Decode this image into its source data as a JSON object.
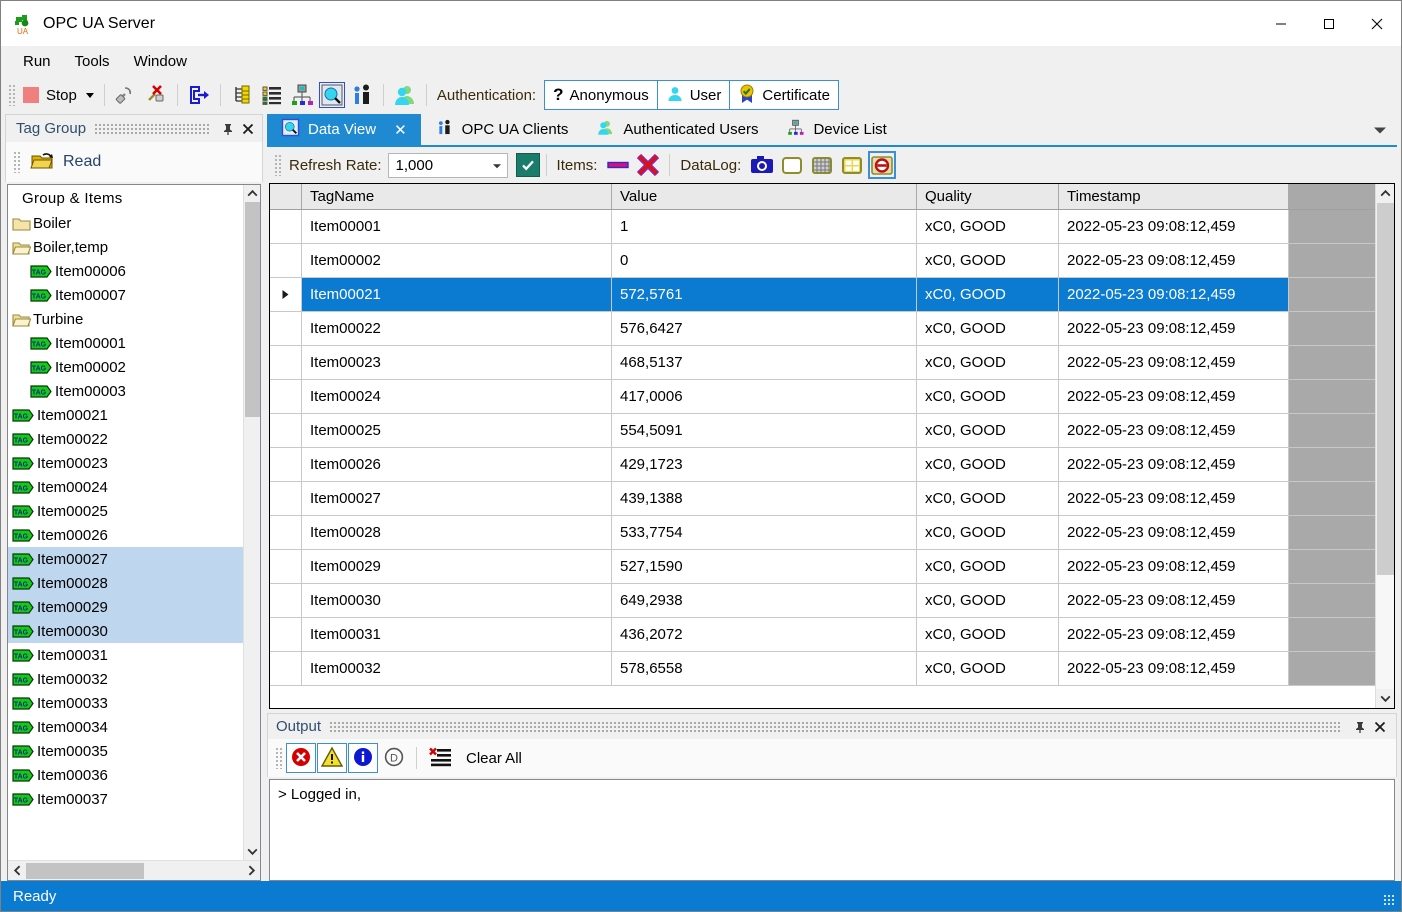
{
  "window": {
    "title": "OPC UA Server",
    "app_icon": "opc-ua-logo-icon",
    "minimize": "minimize-icon",
    "maximize": "maximize-icon",
    "close": "close-icon"
  },
  "menubar": {
    "items": [
      "Run",
      "Tools",
      "Window"
    ]
  },
  "toolbar": {
    "stop_label": "Stop",
    "dropdown_caret": "caret-down-icon",
    "icons": [
      "connect-icon",
      "disconnect-icon",
      "exit-icon",
      "tag-tree-icon",
      "item-list-icon",
      "device-list-icon",
      "data-view-icon",
      "opc-ua-clients-icon",
      "authenticated-users-icon"
    ],
    "auth_label": "Authentication:",
    "auth_buttons": [
      {
        "label": "Anonymous",
        "icon": "question-mark-icon"
      },
      {
        "label": "User",
        "icon": "user-icon"
      },
      {
        "label": "Certificate",
        "icon": "certificate-icon"
      }
    ]
  },
  "tag_group_panel": {
    "title": "Tag Group",
    "pin": "pin-icon",
    "close": "close-icon",
    "read_label": "Read",
    "read_icon": "open-folder-refresh-icon",
    "tree_header": "Group & Items",
    "nodes": [
      {
        "label": "Boiler",
        "type": "folder-closed",
        "indent": 0,
        "selected": false
      },
      {
        "label": "Boiler,temp",
        "type": "folder-open",
        "indent": 0,
        "selected": false
      },
      {
        "label": "Item00006",
        "type": "tag",
        "indent": 1,
        "selected": false
      },
      {
        "label": "Item00007",
        "type": "tag",
        "indent": 1,
        "selected": false
      },
      {
        "label": "Turbine",
        "type": "folder-open",
        "indent": 0,
        "selected": false
      },
      {
        "label": "Item00001",
        "type": "tag",
        "indent": 1,
        "selected": false
      },
      {
        "label": "Item00002",
        "type": "tag",
        "indent": 1,
        "selected": false
      },
      {
        "label": "Item00003",
        "type": "tag",
        "indent": 1,
        "selected": false
      },
      {
        "label": "Item00021",
        "type": "tag",
        "indent": 0,
        "selected": false
      },
      {
        "label": "Item00022",
        "type": "tag",
        "indent": 0,
        "selected": false
      },
      {
        "label": "Item00023",
        "type": "tag",
        "indent": 0,
        "selected": false
      },
      {
        "label": "Item00024",
        "type": "tag",
        "indent": 0,
        "selected": false
      },
      {
        "label": "Item00025",
        "type": "tag",
        "indent": 0,
        "selected": false
      },
      {
        "label": "Item00026",
        "type": "tag",
        "indent": 0,
        "selected": false
      },
      {
        "label": "Item00027",
        "type": "tag",
        "indent": 0,
        "selected": true
      },
      {
        "label": "Item00028",
        "type": "tag",
        "indent": 0,
        "selected": true
      },
      {
        "label": "Item00029",
        "type": "tag",
        "indent": 0,
        "selected": true
      },
      {
        "label": "Item00030",
        "type": "tag",
        "indent": 0,
        "selected": true
      },
      {
        "label": "Item00031",
        "type": "tag",
        "indent": 0,
        "selected": false
      },
      {
        "label": "Item00032",
        "type": "tag",
        "indent": 0,
        "selected": false
      },
      {
        "label": "Item00033",
        "type": "tag",
        "indent": 0,
        "selected": false
      },
      {
        "label": "Item00034",
        "type": "tag",
        "indent": 0,
        "selected": false
      },
      {
        "label": "Item00035",
        "type": "tag",
        "indent": 0,
        "selected": false
      },
      {
        "label": "Item00036",
        "type": "tag",
        "indent": 0,
        "selected": false
      },
      {
        "label": "Item00037",
        "type": "tag",
        "indent": 0,
        "selected": false
      }
    ]
  },
  "tabs": [
    {
      "label": "Data View",
      "icon": "data-view-icon",
      "active": true,
      "closable": true
    },
    {
      "label": "OPC UA Clients",
      "icon": "opc-ua-clients-icon",
      "active": false,
      "closable": false
    },
    {
      "label": "Authenticated Users",
      "icon": "authenticated-users-icon",
      "active": false,
      "closable": false
    },
    {
      "label": "Device List",
      "icon": "device-list-icon",
      "active": false,
      "closable": false
    }
  ],
  "view_toolbar": {
    "refresh_label": "Refresh Rate:",
    "refresh_value": "1,000",
    "refresh_check": "checked",
    "items_label": "Items:",
    "items_icons": [
      "remove-item-icon",
      "delete-all-items-icon"
    ],
    "datalog_label": "DataLog:",
    "datalog_icons": [
      "snapshot-icon",
      "new-log-icon",
      "grid-log-icon",
      "split-log-icon",
      "stop-log-icon"
    ]
  },
  "grid": {
    "columns": [
      "",
      "TagName",
      "Value",
      "Quality",
      "Timestamp"
    ],
    "rows": [
      {
        "tag": "Item00001",
        "value": "1",
        "quality": "xC0, GOOD",
        "timestamp": "2022-05-23 09:08:12,459",
        "selected": false
      },
      {
        "tag": "Item00002",
        "value": "0",
        "quality": "xC0, GOOD",
        "timestamp": "2022-05-23 09:08:12,459",
        "selected": false
      },
      {
        "tag": "Item00021",
        "value": "572,5761",
        "quality": "xC0, GOOD",
        "timestamp": "2022-05-23 09:08:12,459",
        "selected": true
      },
      {
        "tag": "Item00022",
        "value": "576,6427",
        "quality": "xC0, GOOD",
        "timestamp": "2022-05-23 09:08:12,459",
        "selected": false
      },
      {
        "tag": "Item00023",
        "value": "468,5137",
        "quality": "xC0, GOOD",
        "timestamp": "2022-05-23 09:08:12,459",
        "selected": false
      },
      {
        "tag": "Item00024",
        "value": "417,0006",
        "quality": "xC0, GOOD",
        "timestamp": "2022-05-23 09:08:12,459",
        "selected": false
      },
      {
        "tag": "Item00025",
        "value": "554,5091",
        "quality": "xC0, GOOD",
        "timestamp": "2022-05-23 09:08:12,459",
        "selected": false
      },
      {
        "tag": "Item00026",
        "value": "429,1723",
        "quality": "xC0, GOOD",
        "timestamp": "2022-05-23 09:08:12,459",
        "selected": false
      },
      {
        "tag": "Item00027",
        "value": "439,1388",
        "quality": "xC0, GOOD",
        "timestamp": "2022-05-23 09:08:12,459",
        "selected": false
      },
      {
        "tag": "Item00028",
        "value": "533,7754",
        "quality": "xC0, GOOD",
        "timestamp": "2022-05-23 09:08:12,459",
        "selected": false
      },
      {
        "tag": "Item00029",
        "value": "527,1590",
        "quality": "xC0, GOOD",
        "timestamp": "2022-05-23 09:08:12,459",
        "selected": false
      },
      {
        "tag": "Item00030",
        "value": "649,2938",
        "quality": "xC0, GOOD",
        "timestamp": "2022-05-23 09:08:12,459",
        "selected": false
      },
      {
        "tag": "Item00031",
        "value": "436,2072",
        "quality": "xC0, GOOD",
        "timestamp": "2022-05-23 09:08:12,459",
        "selected": false
      },
      {
        "tag": "Item00032",
        "value": "578,6558",
        "quality": "xC0, GOOD",
        "timestamp": "2022-05-23 09:08:12,459",
        "selected": false
      }
    ],
    "row_marker": "current-row-arrow-icon"
  },
  "output_panel": {
    "title": "Output",
    "pin": "pin-icon",
    "close": "close-icon",
    "filters": [
      {
        "name": "error-filter",
        "icon": "error-icon",
        "on": true
      },
      {
        "name": "warning-filter",
        "icon": "warning-icon",
        "on": true
      },
      {
        "name": "info-filter",
        "icon": "info-icon",
        "on": true
      },
      {
        "name": "debug-filter",
        "icon": "debug-icon",
        "on": false
      }
    ],
    "clear_label": "Clear All",
    "clear_icon": "clear-all-icon",
    "lines": [
      "> Logged in,"
    ]
  },
  "statusbar": {
    "text": "Ready",
    "accent": "#0b7ad1"
  },
  "colors": {
    "accent_blue": "#0b7ad1",
    "tab_active": "#1f8ad2",
    "selection_row": "#0b7ad1",
    "tree_selection": "#bfd7ee",
    "panel_bg": "#f0f0f0",
    "grid_filler": "#a9a9a9"
  }
}
